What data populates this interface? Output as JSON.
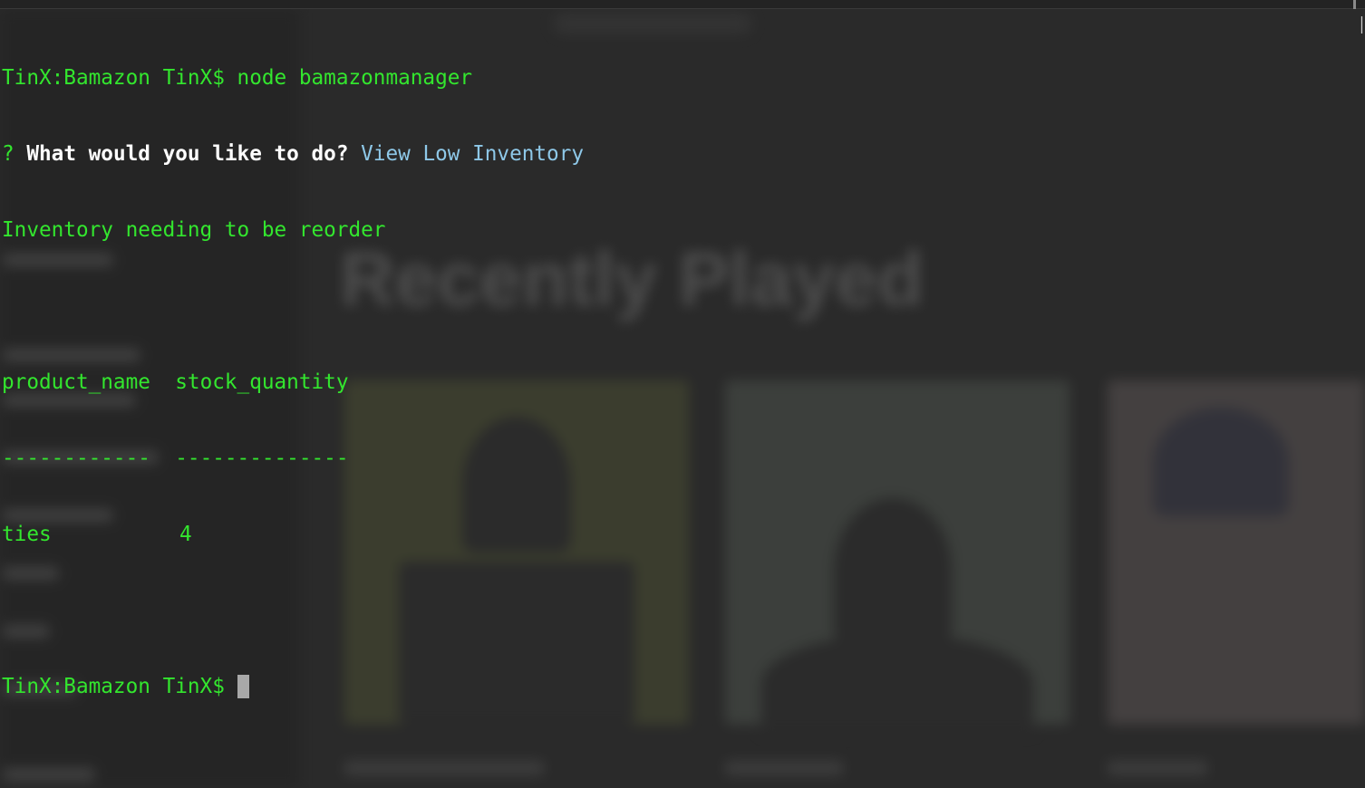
{
  "terminal": {
    "prompt": "TinX:Bamazon TinX$",
    "command": "node bamazonmanager",
    "question_mark": "?",
    "question": "What would you like to do?",
    "answer": "View Low Inventory",
    "message": "Inventory needing to be reorder",
    "table": {
      "headers": [
        "product_name",
        "stock_quantity"
      ],
      "separators": [
        "------------",
        "--------------"
      ],
      "rows": [
        [
          "ties",
          "4"
        ]
      ]
    },
    "final_prompt": "TinX:Bamazon TinX$"
  },
  "background": {
    "heading": "Recently Played"
  },
  "colors": {
    "terminal_green": "#33e62e",
    "answer_cyan": "#8ec8e8",
    "question_white": "#ffffff",
    "cursor_gray": "#a8a8a8",
    "background": "#2a2a2a"
  }
}
